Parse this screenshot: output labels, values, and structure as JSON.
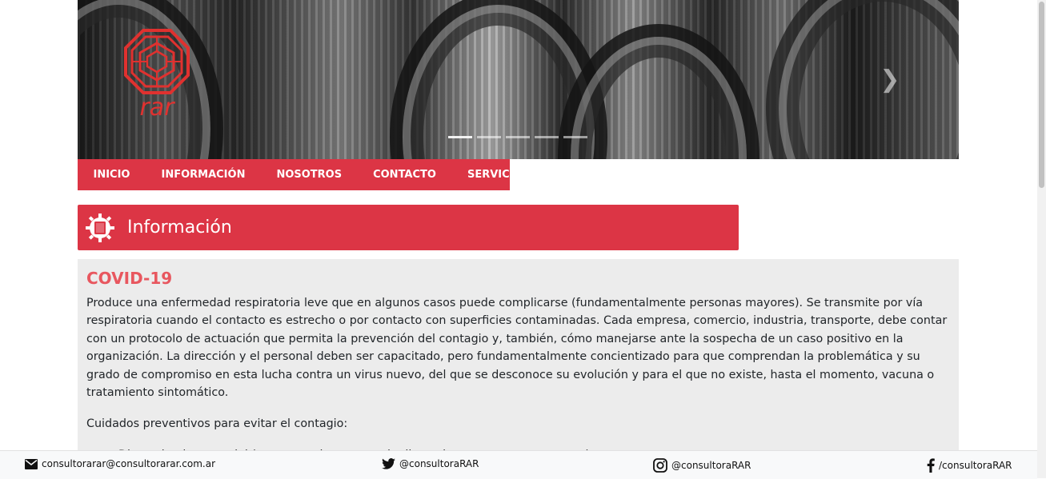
{
  "hero": {
    "logo_text": "rar",
    "slides": 5,
    "active_slide": 1
  },
  "nav": {
    "items": [
      "INICIO",
      "INFORMACIÓN",
      "NOSOTROS",
      "CONTACTO",
      "SERVICIOS"
    ]
  },
  "section": {
    "title": "Información"
  },
  "content": {
    "heading": "COVID-19",
    "paragraph": "Produce una enfermedad respiratoria leve que en algunos casos puede complicarse (fundamentalmente personas mayores). Se transmite por vía respiratoria cuando el contacto es estrecho o por contacto con superficies contaminadas. Cada empresa, comercio, industria, transporte, debe contar con un protocolo de actuación que permita la prevención del contagio y, también, cómo manejarse ante la sospecha de un caso positivo en la organización. La dirección y el personal deben ser capacitado, pero fundamentalmente concientizado para que comprendan la problemática y su grado de compromiso en esta lucha contra un virus nuevo, del que se desconoce su evolución y para el que no existe, hasta el momento, vacuna o tratamiento sintomático.",
    "intro": "Cuidados preventivos para evitar el contagio:",
    "bullets": [
      "Distanciamiento social (mantener dos metros de distancia segura entre personas)"
    ]
  },
  "footer": {
    "email": "consultorarar@consultorarar.com.ar",
    "twitter": "@consultoraRAR",
    "instagram": "@consultoraRAR",
    "facebook": "/consultoraRAR"
  },
  "colors": {
    "brand_red": "#dc3545",
    "heading_red": "#e8575f",
    "content_bg": "#ececec"
  }
}
